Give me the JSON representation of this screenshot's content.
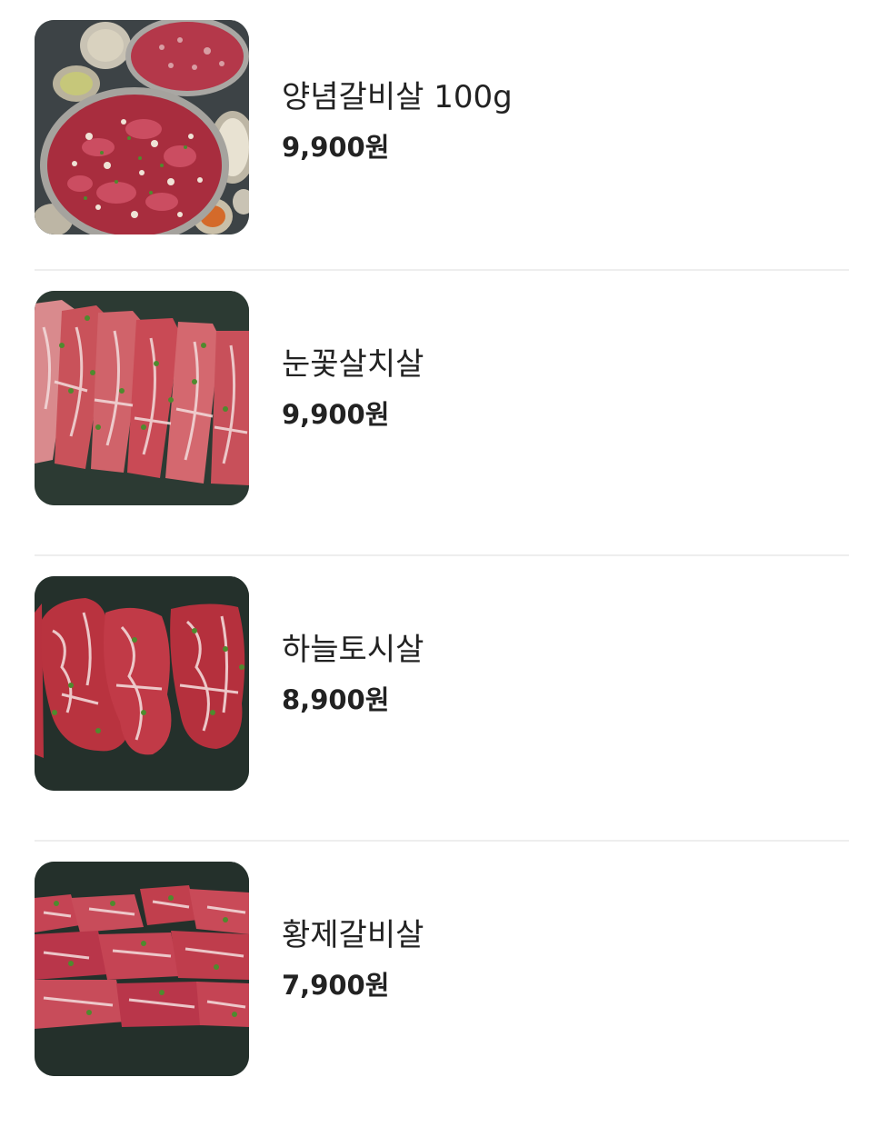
{
  "menu": {
    "items": [
      {
        "name": "양념갈비살 100g",
        "price": "9,900원",
        "image": "marinated-galbi-platter-photo"
      },
      {
        "name": "눈꽃살치살",
        "price": "9,900원",
        "image": "marbled-chuck-flap-photo"
      },
      {
        "name": "하늘토시살",
        "price": "8,900원",
        "image": "hanger-steak-photo"
      },
      {
        "name": "황제갈비살",
        "price": "7,900원",
        "image": "rib-finger-meat-photo"
      }
    ]
  },
  "colors": {
    "text": "#222222",
    "divider": "#eeeeee",
    "slate": "#2c3a33",
    "meat": "#b8323f",
    "marbling": "#f1d6d6",
    "herb": "#4f8a2e"
  }
}
